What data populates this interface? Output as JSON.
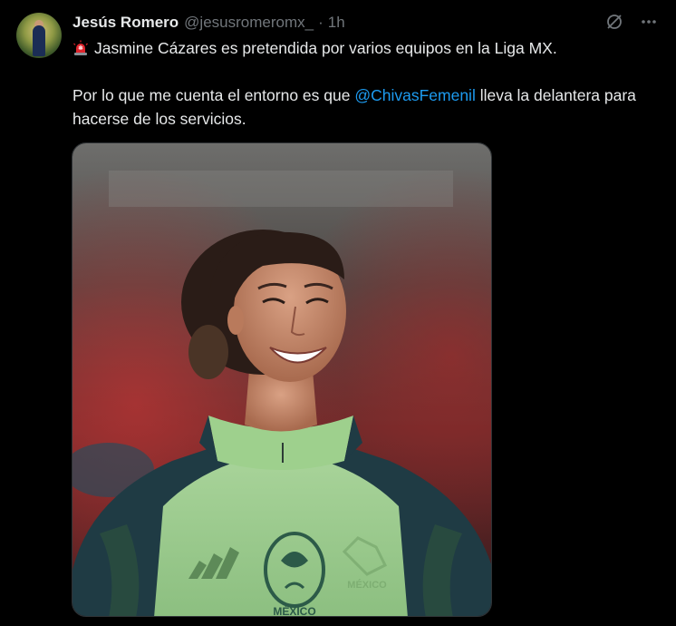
{
  "tweet": {
    "author_name": "Jesús Romero",
    "author_handle": "@jesusromeromx_",
    "separator": "·",
    "time": "1h",
    "icons": {
      "siren": "siren-emoji",
      "grok": "grok-icon",
      "more": "more-icon"
    },
    "paragraph1": "Jasmine Cázares es pretendida por varios equipos en la Liga MX.",
    "paragraph2_before": "Por lo que me cuenta el entorno es que ",
    "mention": "@ChivasFemenil",
    "paragraph2_after": " lleva la delantera para hacerse de los servicios.",
    "mention_color": "#1d9bf0",
    "jersey_text": "MÉXICO",
    "jersey_text_right": "MÉXICO"
  }
}
